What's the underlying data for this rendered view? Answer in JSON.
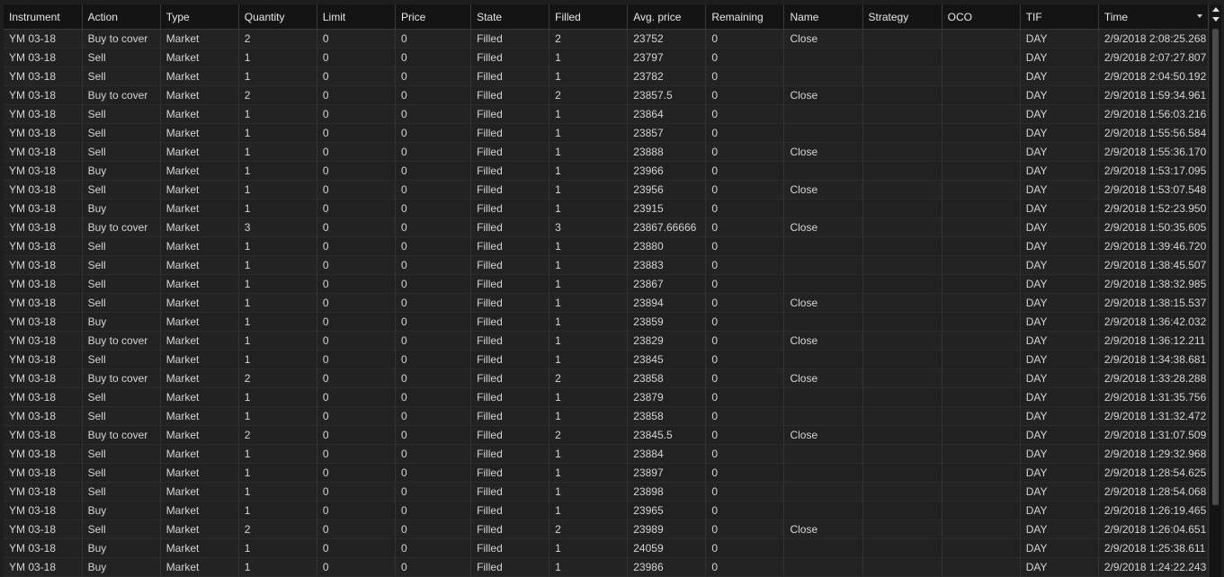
{
  "columns": [
    "Instrument",
    "Action",
    "Type",
    "Quantity",
    "Limit",
    "Price",
    "State",
    "Filled",
    "Avg. price",
    "Remaining",
    "Name",
    "Strategy",
    "OCO",
    "TIF",
    "Time"
  ],
  "rows": [
    [
      "YM 03-18",
      "Buy to cover",
      "Market",
      "2",
      "0",
      "0",
      "Filled",
      "2",
      "23752",
      "0",
      "Close",
      "",
      "",
      "DAY",
      "2/9/2018 2:08:25.268"
    ],
    [
      "YM 03-18",
      "Sell",
      "Market",
      "1",
      "0",
      "0",
      "Filled",
      "1",
      "23797",
      "0",
      "",
      "",
      "",
      "DAY",
      "2/9/2018 2:07:27.807"
    ],
    [
      "YM 03-18",
      "Sell",
      "Market",
      "1",
      "0",
      "0",
      "Filled",
      "1",
      "23782",
      "0",
      "",
      "",
      "",
      "DAY",
      "2/9/2018 2:04:50.192"
    ],
    [
      "YM 03-18",
      "Buy to cover",
      "Market",
      "2",
      "0",
      "0",
      "Filled",
      "2",
      "23857.5",
      "0",
      "Close",
      "",
      "",
      "DAY",
      "2/9/2018 1:59:34.961"
    ],
    [
      "YM 03-18",
      "Sell",
      "Market",
      "1",
      "0",
      "0",
      "Filled",
      "1",
      "23864",
      "0",
      "",
      "",
      "",
      "DAY",
      "2/9/2018 1:56:03.216"
    ],
    [
      "YM 03-18",
      "Sell",
      "Market",
      "1",
      "0",
      "0",
      "Filled",
      "1",
      "23857",
      "0",
      "",
      "",
      "",
      "DAY",
      "2/9/2018 1:55:56.584"
    ],
    [
      "YM 03-18",
      "Sell",
      "Market",
      "1",
      "0",
      "0",
      "Filled",
      "1",
      "23888",
      "0",
      "Close",
      "",
      "",
      "DAY",
      "2/9/2018 1:55:36.170"
    ],
    [
      "YM 03-18",
      "Buy",
      "Market",
      "1",
      "0",
      "0",
      "Filled",
      "1",
      "23966",
      "0",
      "",
      "",
      "",
      "DAY",
      "2/9/2018 1:53:17.095"
    ],
    [
      "YM 03-18",
      "Sell",
      "Market",
      "1",
      "0",
      "0",
      "Filled",
      "1",
      "23956",
      "0",
      "Close",
      "",
      "",
      "DAY",
      "2/9/2018 1:53:07.548"
    ],
    [
      "YM 03-18",
      "Buy",
      "Market",
      "1",
      "0",
      "0",
      "Filled",
      "1",
      "23915",
      "0",
      "",
      "",
      "",
      "DAY",
      "2/9/2018 1:52:23.950"
    ],
    [
      "YM 03-18",
      "Buy to cover",
      "Market",
      "3",
      "0",
      "0",
      "Filled",
      "3",
      "23867.66666",
      "0",
      "Close",
      "",
      "",
      "DAY",
      "2/9/2018 1:50:35.605"
    ],
    [
      "YM 03-18",
      "Sell",
      "Market",
      "1",
      "0",
      "0",
      "Filled",
      "1",
      "23880",
      "0",
      "",
      "",
      "",
      "DAY",
      "2/9/2018 1:39:46.720"
    ],
    [
      "YM 03-18",
      "Sell",
      "Market",
      "1",
      "0",
      "0",
      "Filled",
      "1",
      "23883",
      "0",
      "",
      "",
      "",
      "DAY",
      "2/9/2018 1:38:45.507"
    ],
    [
      "YM 03-18",
      "Sell",
      "Market",
      "1",
      "0",
      "0",
      "Filled",
      "1",
      "23867",
      "0",
      "",
      "",
      "",
      "DAY",
      "2/9/2018 1:38:32.985"
    ],
    [
      "YM 03-18",
      "Sell",
      "Market",
      "1",
      "0",
      "0",
      "Filled",
      "1",
      "23894",
      "0",
      "Close",
      "",
      "",
      "DAY",
      "2/9/2018 1:38:15.537"
    ],
    [
      "YM 03-18",
      "Buy",
      "Market",
      "1",
      "0",
      "0",
      "Filled",
      "1",
      "23859",
      "0",
      "",
      "",
      "",
      "DAY",
      "2/9/2018 1:36:42.032"
    ],
    [
      "YM 03-18",
      "Buy to cover",
      "Market",
      "1",
      "0",
      "0",
      "Filled",
      "1",
      "23829",
      "0",
      "Close",
      "",
      "",
      "DAY",
      "2/9/2018 1:36:12.211"
    ],
    [
      "YM 03-18",
      "Sell",
      "Market",
      "1",
      "0",
      "0",
      "Filled",
      "1",
      "23845",
      "0",
      "",
      "",
      "",
      "DAY",
      "2/9/2018 1:34:38.681"
    ],
    [
      "YM 03-18",
      "Buy to cover",
      "Market",
      "2",
      "0",
      "0",
      "Filled",
      "2",
      "23858",
      "0",
      "Close",
      "",
      "",
      "DAY",
      "2/9/2018 1:33:28.288"
    ],
    [
      "YM 03-18",
      "Sell",
      "Market",
      "1",
      "0",
      "0",
      "Filled",
      "1",
      "23879",
      "0",
      "",
      "",
      "",
      "DAY",
      "2/9/2018 1:31:35.756"
    ],
    [
      "YM 03-18",
      "Sell",
      "Market",
      "1",
      "0",
      "0",
      "Filled",
      "1",
      "23858",
      "0",
      "",
      "",
      "",
      "DAY",
      "2/9/2018 1:31:32.472"
    ],
    [
      "YM 03-18",
      "Buy to cover",
      "Market",
      "2",
      "0",
      "0",
      "Filled",
      "2",
      "23845.5",
      "0",
      "Close",
      "",
      "",
      "DAY",
      "2/9/2018 1:31:07.509"
    ],
    [
      "YM 03-18",
      "Sell",
      "Market",
      "1",
      "0",
      "0",
      "Filled",
      "1",
      "23884",
      "0",
      "",
      "",
      "",
      "DAY",
      "2/9/2018 1:29:32.968"
    ],
    [
      "YM 03-18",
      "Sell",
      "Market",
      "1",
      "0",
      "0",
      "Filled",
      "1",
      "23897",
      "0",
      "",
      "",
      "",
      "DAY",
      "2/9/2018 1:28:54.625"
    ],
    [
      "YM 03-18",
      "Sell",
      "Market",
      "1",
      "0",
      "0",
      "Filled",
      "1",
      "23898",
      "0",
      "",
      "",
      "",
      "DAY",
      "2/9/2018 1:28:54.068"
    ],
    [
      "YM 03-18",
      "Buy",
      "Market",
      "1",
      "0",
      "0",
      "Filled",
      "1",
      "23965",
      "0",
      "",
      "",
      "",
      "DAY",
      "2/9/2018 1:26:19.465"
    ],
    [
      "YM 03-18",
      "Sell",
      "Market",
      "2",
      "0",
      "0",
      "Filled",
      "2",
      "23989",
      "0",
      "Close",
      "",
      "",
      "DAY",
      "2/9/2018 1:26:04.651"
    ],
    [
      "YM 03-18",
      "Buy",
      "Market",
      "1",
      "0",
      "0",
      "Filled",
      "1",
      "24059",
      "0",
      "",
      "",
      "",
      "DAY",
      "2/9/2018 1:25:38.611"
    ],
    [
      "YM 03-18",
      "Buy",
      "Market",
      "1",
      "0",
      "0",
      "Filled",
      "1",
      "23986",
      "0",
      "",
      "",
      "",
      "DAY",
      "2/9/2018 1:24:22.243"
    ]
  ],
  "sort_icon": "sort-descending-icon",
  "scroll_up_icon": "scroll-up-arrow-icon",
  "scroll_down_icon": "scroll-down-arrow-icon"
}
